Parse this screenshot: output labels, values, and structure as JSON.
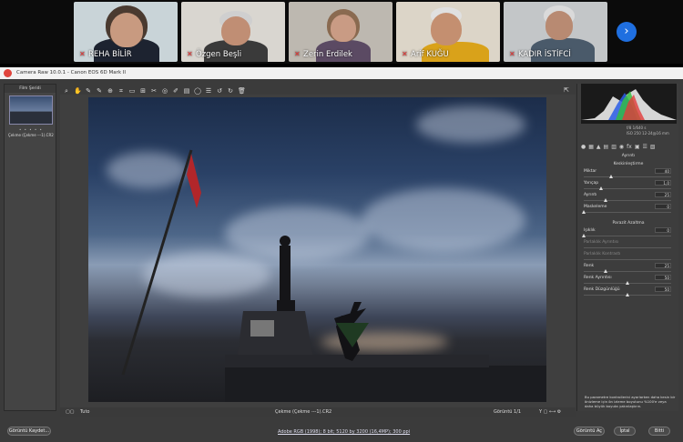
{
  "participants": [
    {
      "name": "REHA BİLİR",
      "bg": "#c9d4d8",
      "skin": "#c89a80",
      "shirt": "#1d2330",
      "hair": "#4a3a30"
    },
    {
      "name": "Özgen Beşli",
      "bg": "#d9d6d0",
      "skin": "#c08e74",
      "shirt": "#3a3a3a",
      "hair": "#cfcfcf"
    },
    {
      "name": "Zerin Erdilek",
      "bg": "#bdb8b0",
      "skin": "#c99b84",
      "shirt": "#5b4a63",
      "hair": "#8a6a50"
    },
    {
      "name": "Arif KUĞU",
      "bg": "#dcd5c8",
      "skin": "#c48f70",
      "shirt": "#d9a21a",
      "hair": "#e0e0e0"
    },
    {
      "name": "KADIR İSTİFCİ",
      "bg": "#c3c6c8",
      "skin": "#b88a72",
      "shirt": "#4a5a6a",
      "hair": "#dadada"
    }
  ],
  "app": {
    "title": "Camera Raw 10.0.1  -  Canon EOS 6D Mark II",
    "filmstrip_title": "Film Şeridi",
    "filmstrip_caption": "Çekme (Çekme ---1).CR2",
    "filmstrip_stars": "• • • • •",
    "panel_name": "Ayrıntı",
    "sharpening_title": "Keskinleştirme",
    "noise_title": "Parazit Azaltma",
    "sharpening": [
      {
        "label": "Miktar",
        "value": "40",
        "fraction": 0.31
      },
      {
        "label": "Yarıçap",
        "value": "1,0",
        "fraction": 0.2
      },
      {
        "label": "Ayrıntı",
        "value": "25",
        "fraction": 0.25
      },
      {
        "label": "Maskeleme",
        "value": "0",
        "fraction": 0.0
      }
    ],
    "noise": [
      {
        "label": "Işıklık",
        "value": "0",
        "fraction": 0.0,
        "enabled": true
      },
      {
        "label": "Parlaklık Ayrıntısı",
        "value": "",
        "fraction": 0.0,
        "enabled": false
      },
      {
        "label": "Parlaklık Kontrastı",
        "value": "",
        "fraction": 0.0,
        "enabled": false
      },
      {
        "label": "Renk",
        "value": "25",
        "fraction": 0.25,
        "enabled": true
      },
      {
        "label": "Renk Ayrıntısı",
        "value": "50",
        "fraction": 0.5,
        "enabled": true
      },
      {
        "label": "Renk Düzgünlüğü",
        "value": "50",
        "fraction": 0.5,
        "enabled": true
      }
    ],
    "note": "Bu parametre kontrollerini ayarlarken daha kesin bir önizleme için ön izleme boyutunu %100'e veya daha büyük boyuta yakınlaştırın.",
    "zoom": "Tuto",
    "file_label": "Çekme (Çekme ---1).CR2",
    "page_label": "Görüntü 1/1",
    "info_line_1": "f/8    1/640 s",
    "info_line_2": "ISO 250   12-24@16 mm",
    "workflow_link": "Adobe RGB (1998); 8 bit; 5120 by 3200 (16,4MP); 300 ppi",
    "save_button": "Görüntü Kaydet...",
    "open_button": "Görüntü Aç",
    "cancel_button": "İptal",
    "done_button": "Bitti"
  }
}
